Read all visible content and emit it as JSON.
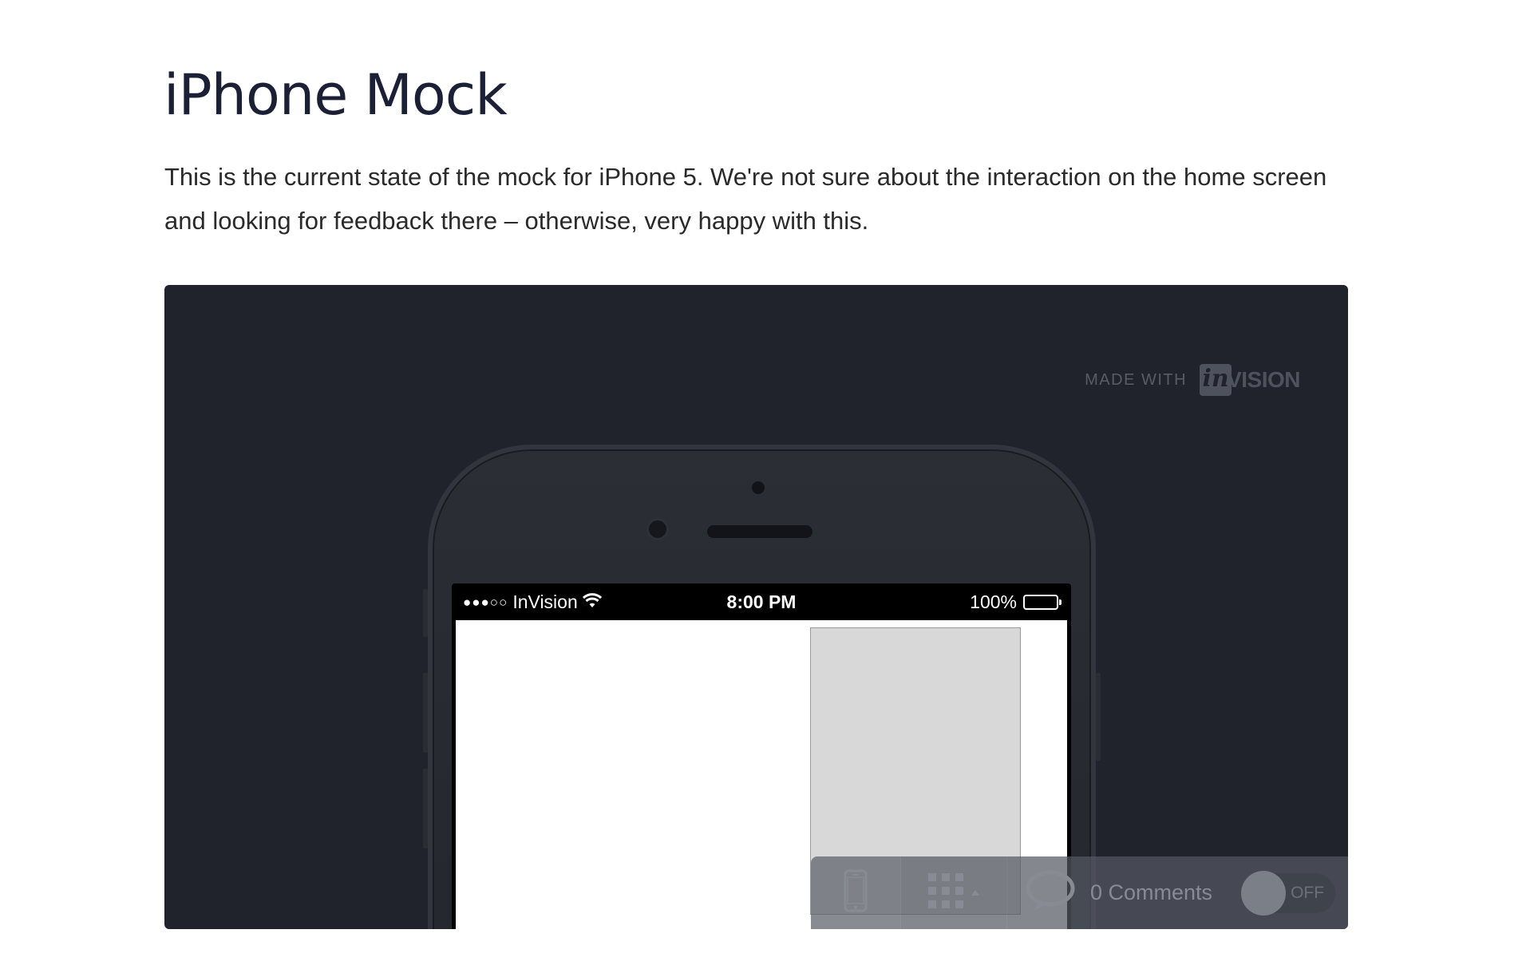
{
  "page": {
    "title": "iPhone Mock",
    "description": "This is the current state of the mock for iPhone 5. We're not sure about the interaction on the home screen and looking for feedback there – otherwise, very happy with this."
  },
  "embed": {
    "badge": {
      "text": "MADE WITH",
      "logo_mark": "in",
      "logo_word": "VISION"
    },
    "phone": {
      "status_bar": {
        "signal": "●●●○○",
        "carrier": "InVision",
        "time": "8:00 PM",
        "battery": "100%"
      }
    },
    "toolbar": {
      "device_icon": "phone-icon",
      "grid_icon": "grid-icon",
      "comments_icon": "speech-bubble-icon",
      "comments_label": "0 Comments",
      "toggle_label": "OFF"
    }
  }
}
